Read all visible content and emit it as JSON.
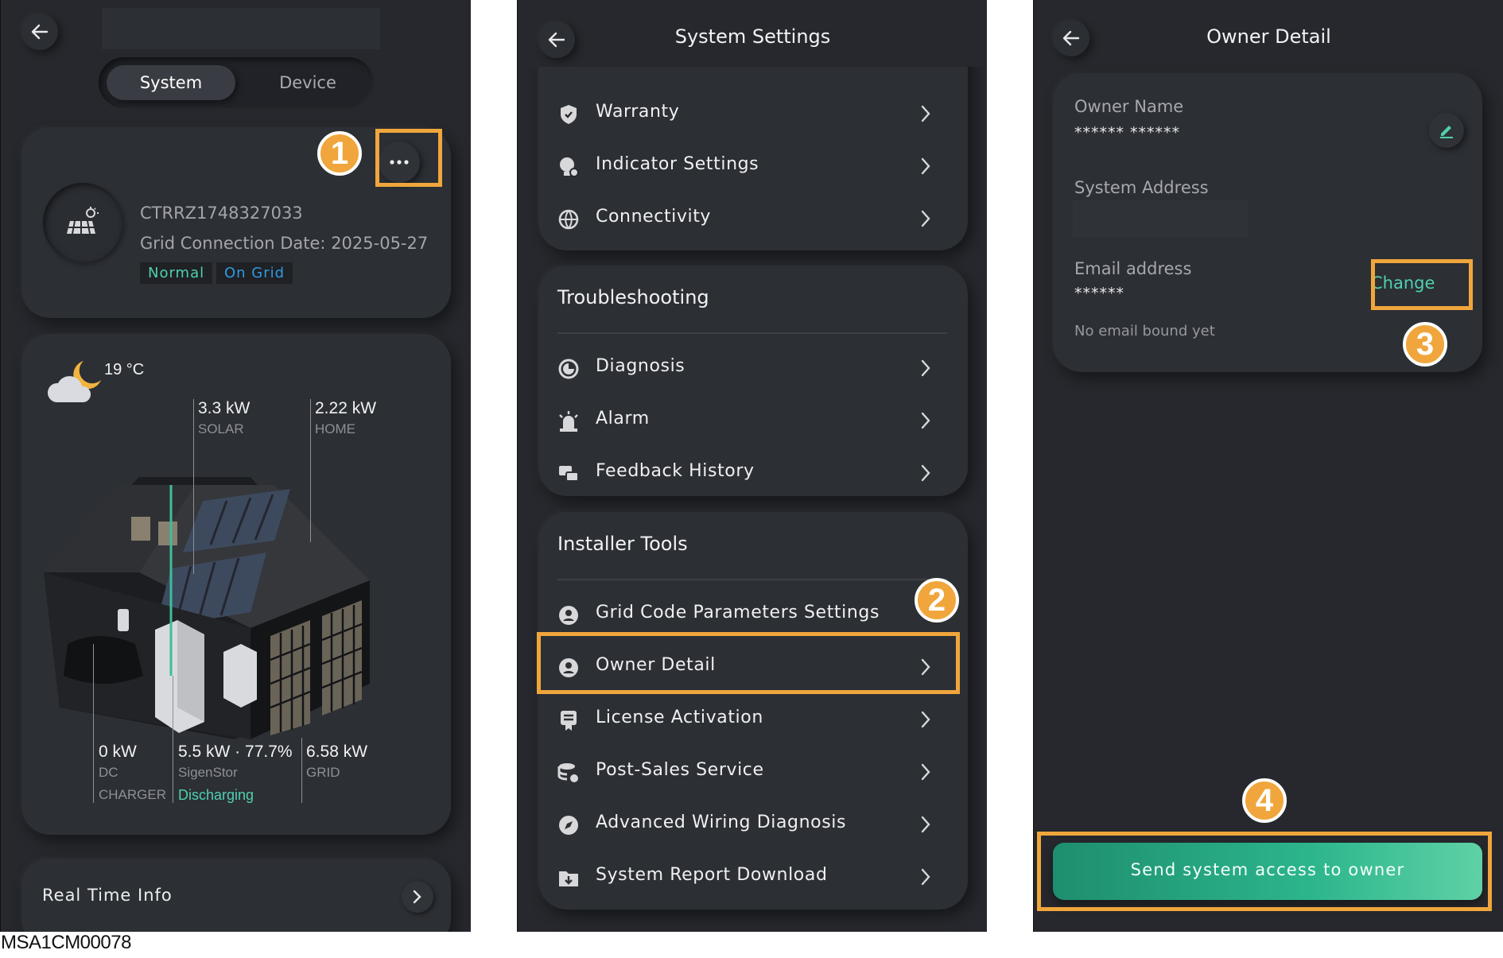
{
  "panel1": {
    "tabs": [
      "System",
      "Device"
    ],
    "system_id": "CTRRZ1748327033",
    "grid_connection": "Grid Connection Date: 2025-05-27",
    "status_tags": [
      "Normal",
      "On Grid"
    ],
    "weather": {
      "icon": "moon-cloud-icon",
      "temperature": "19 °C"
    },
    "flows": {
      "solar": {
        "value": "3.3 kW",
        "label": "SOLAR"
      },
      "home": {
        "value": "2.22 kW",
        "label": "HOME"
      },
      "dc_charger": {
        "value": "0 kW",
        "label1": "DC",
        "label2": "CHARGER"
      },
      "battery": {
        "value": "5.5 kW · 77.7%",
        "label": "SigenStor",
        "state": "Discharging"
      },
      "grid": {
        "value": "6.58 kW",
        "label": "GRID"
      }
    },
    "real_time_info": "Real Time Info"
  },
  "panel2": {
    "title": "System Settings",
    "top_items": [
      "Warranty",
      "Indicator Settings",
      "Connectivity"
    ],
    "troubleshooting": {
      "title": "Troubleshooting",
      "items": [
        "Diagnosis",
        "Alarm",
        "Feedback History"
      ]
    },
    "installer_tools": {
      "title": "Installer Tools",
      "items": [
        "Grid Code Parameters Settings",
        "Owner Detail",
        "License Activation",
        "Post-Sales Service",
        "Advanced Wiring Diagnosis",
        "System Report Download"
      ]
    }
  },
  "panel3": {
    "title": "Owner Detail",
    "owner_name_label": "Owner Name",
    "owner_name_value": "****** ******",
    "system_address_label": "System Address",
    "email_label": "Email address",
    "email_value": "******",
    "email_note": "No email bound yet",
    "change_label": "Change",
    "send_button": "Send system access to owner"
  },
  "steps": [
    "1",
    "2",
    "3",
    "4"
  ],
  "caption": "MSA1CM00078",
  "colors": {
    "accent_orange": "#f0a63c",
    "accent_teal": "#4fd0b0",
    "on_grid_blue": "#2f9be0",
    "panel_bg": "#26282d"
  }
}
